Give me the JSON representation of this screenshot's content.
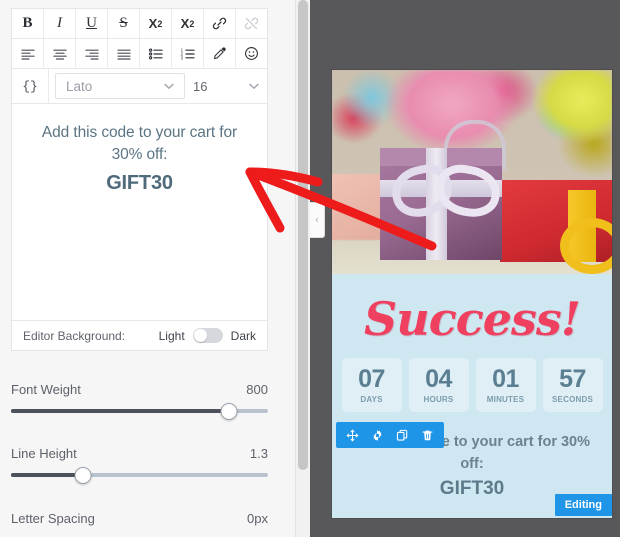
{
  "editor": {
    "toolbar_row1": [
      {
        "name": "bold",
        "label": "B"
      },
      {
        "name": "italic",
        "label": "I"
      },
      {
        "name": "underline",
        "label": "U"
      },
      {
        "name": "strikethrough",
        "label": "S"
      },
      {
        "name": "superscript",
        "label": "X"
      },
      {
        "name": "subscript",
        "label": "X"
      },
      {
        "name": "link",
        "label": ""
      },
      {
        "name": "unlink",
        "label": ""
      }
    ],
    "toolbar_row2": [
      {
        "name": "align-left",
        "label": ""
      },
      {
        "name": "align-center",
        "label": ""
      },
      {
        "name": "align-right",
        "label": ""
      },
      {
        "name": "align-justify",
        "label": ""
      },
      {
        "name": "bulleted-list",
        "label": ""
      },
      {
        "name": "numbered-list",
        "label": ""
      },
      {
        "name": "eyedropper",
        "label": ""
      },
      {
        "name": "emoji",
        "label": ""
      }
    ],
    "code_button_label": "{}",
    "font_family": "Lato",
    "font_size": "16",
    "canvas_line1": "Add this code to your cart for 30% off:",
    "canvas_code": "GIFT30",
    "background_label": "Editor Background:",
    "background_light": "Light",
    "background_dark": "Dark",
    "background_mode": "Light"
  },
  "sliders": [
    {
      "label": "Font Weight",
      "value": "800",
      "percent": 85
    },
    {
      "label": "Line Height",
      "value": "1.3",
      "percent": 28
    },
    {
      "label": "Letter Spacing",
      "value": "0px",
      "percent": 0
    }
  ],
  "preview": {
    "collapse_label": "‹",
    "headline": "Success!",
    "countdown": [
      {
        "value": "07",
        "label": "DAYS"
      },
      {
        "value": "04",
        "label": "HOURS"
      },
      {
        "value": "01",
        "label": "MINUTES"
      },
      {
        "value": "57",
        "label": "SECONDS"
      }
    ],
    "text_line1": "Add this code to your cart for 30% off:",
    "text_code": "GIFT30",
    "element_toolbar": [
      {
        "name": "move-icon"
      },
      {
        "name": "gear-icon"
      },
      {
        "name": "duplicate-icon"
      },
      {
        "name": "trash-icon"
      }
    ],
    "editing_badge": "Editing"
  },
  "colors": {
    "accent_blue": "#1f95e8",
    "headline_pink": "#ef4060",
    "preview_bg": "#cfe7f1",
    "stage_bg": "#58585a",
    "annotation_red": "#ee1b1b"
  }
}
